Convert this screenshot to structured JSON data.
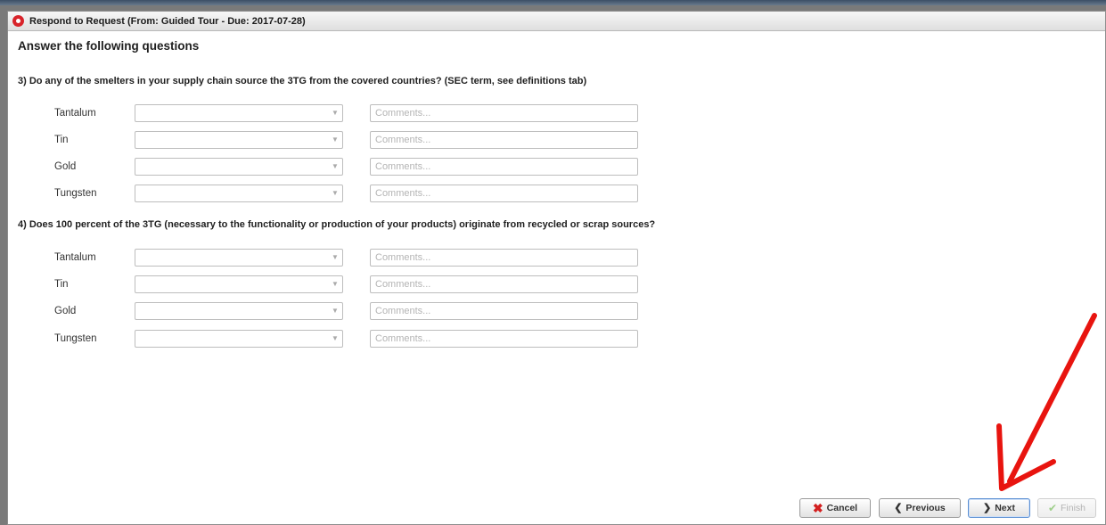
{
  "dialog": {
    "title": "Respond to Request (From: Guided Tour - Due: 2017-07-28)",
    "heading": "Answer the following questions"
  },
  "questions": [
    {
      "text": "3) Do any of the smelters in your supply chain source the 3TG from the covered countries? (SEC term, see definitions tab)",
      "rows": [
        {
          "label": "Tantalum",
          "value": "",
          "comment_placeholder": "Comments..."
        },
        {
          "label": "Tin",
          "value": "",
          "comment_placeholder": "Comments..."
        },
        {
          "label": "Gold",
          "value": "",
          "comment_placeholder": "Comments..."
        },
        {
          "label": "Tungsten",
          "value": "",
          "comment_placeholder": "Comments..."
        }
      ]
    },
    {
      "text": "4) Does 100 percent of the 3TG (necessary to the functionality or production of your products) originate from recycled or scrap sources?",
      "rows": [
        {
          "label": "Tantalum",
          "value": "",
          "comment_placeholder": "Comments..."
        },
        {
          "label": "Tin",
          "value": "",
          "comment_placeholder": "Comments..."
        },
        {
          "label": "Gold",
          "value": "",
          "comment_placeholder": "Comments..."
        },
        {
          "label": "Tungsten",
          "value": "",
          "comment_placeholder": "Comments..."
        }
      ]
    }
  ],
  "footer": {
    "cancel_label": "Cancel",
    "previous_label": "Previous",
    "next_label": "Next",
    "finish_label": "Finish"
  },
  "colors": {
    "title_icon": "#d8232a",
    "annotation_arrow": "#e8140f",
    "cancel_icon": "#d32020",
    "finish_icon_disabled": "#9fcf8b"
  },
  "icons": {
    "title": "record-icon",
    "cancel": "x-icon",
    "previous": "chevron-left-icon",
    "next": "chevron-right-icon",
    "finish": "check-icon",
    "dropdown": "chevron-down-icon"
  }
}
